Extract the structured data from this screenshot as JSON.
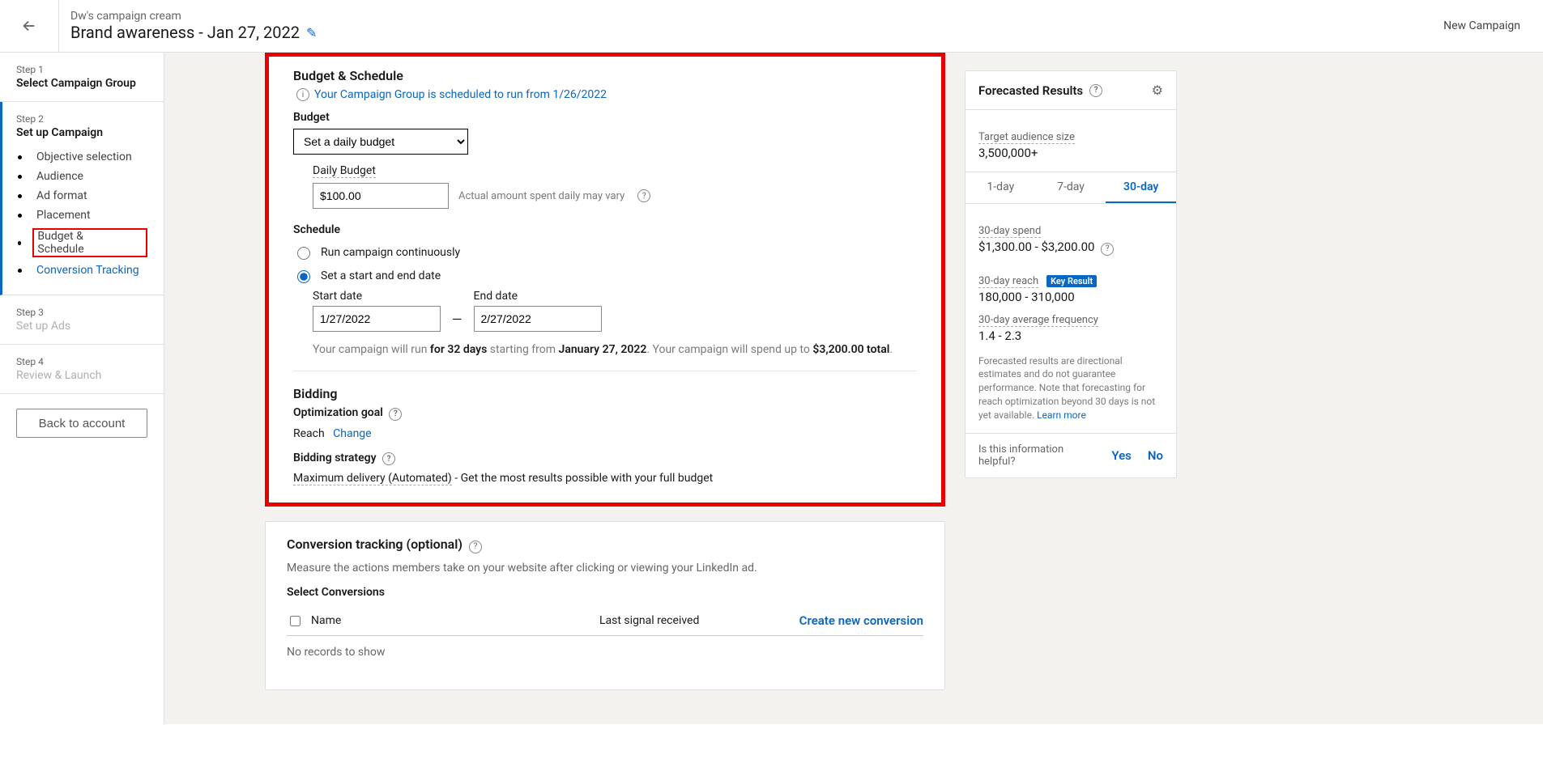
{
  "top": {
    "group_name": "Dw's campaign cream",
    "campaign_title": "Brand awareness - Jan 27, 2022",
    "right_text": "New Campaign"
  },
  "sidebar": {
    "steps": {
      "s1": {
        "num": "Step 1",
        "title": "Select Campaign Group"
      },
      "s2": {
        "num": "Step 2",
        "title": "Set up Campaign",
        "items": [
          "Objective selection",
          "Audience",
          "Ad format",
          "Placement",
          "Budget & Schedule",
          "Conversion Tracking"
        ]
      },
      "s3": {
        "num": "Step 3",
        "title": "Set up Ads"
      },
      "s4": {
        "num": "Step 4",
        "title": "Review & Launch"
      }
    },
    "back_btn": "Back to account"
  },
  "budget": {
    "section_title": "Budget & Schedule",
    "info": "Your Campaign Group is scheduled to run from 1/26/2022",
    "budget_label": "Budget",
    "budget_select": "Set a daily budget",
    "daily_budget_label": "Daily Budget",
    "daily_budget_value": "$100.00",
    "daily_hint": "Actual amount spent daily may vary",
    "schedule_label": "Schedule",
    "radio_continuous": "Run campaign continuously",
    "radio_startend": "Set a start and end date",
    "start_label": "Start date",
    "start_value": "1/27/2022",
    "end_label": "End date",
    "end_value": "2/27/2022",
    "summary_pre": "Your campaign will run ",
    "summary_days": "for 32 days",
    "summary_mid": " starting from ",
    "summary_date": "January 27, 2022",
    "summary_post": ". Your campaign will spend up to ",
    "summary_amount": "$3,200.00 total",
    "summary_end": "."
  },
  "bidding": {
    "title": "Bidding",
    "opt_goal_label": "Optimization goal",
    "opt_goal_value": "Reach",
    "change": "Change",
    "strategy_label": "Bidding strategy",
    "strategy_value": "Maximum delivery (Automated)",
    "strategy_desc": " - Get the most results possible with your full budget"
  },
  "conversion": {
    "title": "Conversion tracking (optional)",
    "desc": "Measure the actions members take on your website after clicking or viewing your LinkedIn ad.",
    "select_label": "Select Conversions",
    "col_name": "Name",
    "col_last": "Last signal received",
    "create": "Create new conversion",
    "empty": "No records to show"
  },
  "forecast": {
    "title": "Forecasted Results",
    "audience_label": "Target audience size",
    "audience_value": "3,500,000+",
    "tabs": [
      "1-day",
      "7-day",
      "30-day"
    ],
    "spend_label": "30-day spend",
    "spend_value": "$1,300.00 - $3,200.00",
    "reach_label": "30-day reach",
    "key_result": "Key Result",
    "reach_value": "180,000 - 310,000",
    "freq_label": "30-day average frequency",
    "freq_value": "1.4 - 2.3",
    "note": "Forecasted results are directional estimates and do not guarantee performance. Note that forecasting for reach optimization beyond 30 days is not yet available. ",
    "learn_more": "Learn more",
    "feedback_q": "Is this information helpful?",
    "yes": "Yes",
    "no": "No"
  }
}
